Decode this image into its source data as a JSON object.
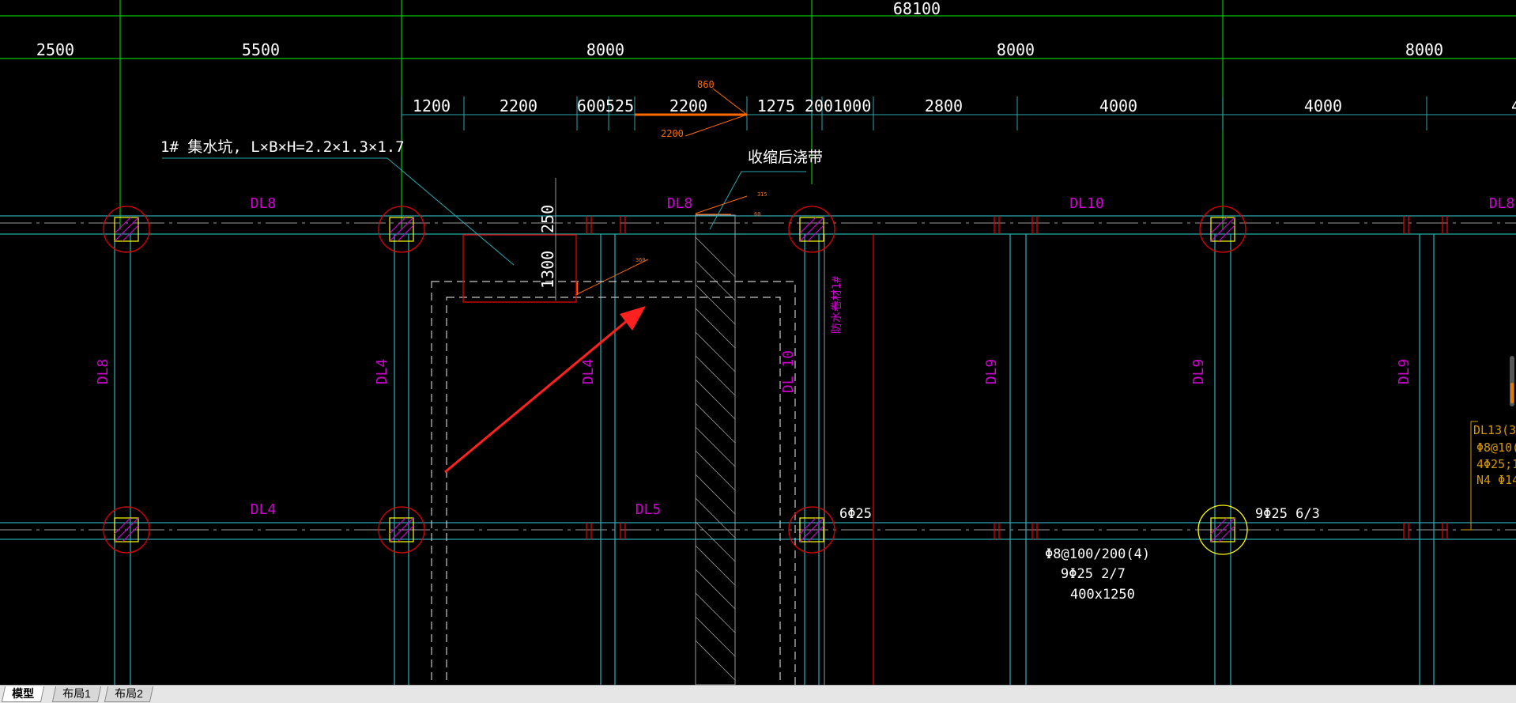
{
  "colors": {
    "grid_axis": "#00c800",
    "beam": "#2aa6b0",
    "beam_label": "#d000d0",
    "column_ring": "#e00000",
    "column_hatch": "#ffff00",
    "dim_text": "#ffffff",
    "annotation_orange": "#ff6a00",
    "note_orange": "#d89800",
    "arrow": "#ff2020",
    "dashed": "#c8c8c8"
  },
  "dims": {
    "total": "68100",
    "axis_spans": [
      "2500",
      "5500",
      "8000",
      "8000",
      "8000"
    ],
    "secondary": [
      "1200",
      "2200",
      "600525",
      "2200",
      "1275 2001000",
      "2800",
      "4000",
      "4000",
      "4"
    ],
    "orange_top": "860",
    "orange_bottom": "2200",
    "pit_width": "250",
    "pit_depth": "1300"
  },
  "annotations": {
    "sump_pit": "1# 集水坑, L×B×H=2.2×1.3×1.7",
    "post_pour_strip": "收缩后浇带",
    "waterproof": "防水卷材1# ",
    "small_orange_1": "315",
    "small_orange_2": "60",
    "small_orange_3": "360"
  },
  "beams": {
    "top_row": [
      "DL8",
      "DL8",
      "DL10",
      "DL8"
    ],
    "mid_row": [
      "DL4",
      "DL5"
    ],
    "vertical": [
      "DL8",
      "DL4",
      "DL4",
      "DL 10",
      "DL9",
      "DL9",
      "DL9"
    ]
  },
  "rebar": {
    "col_a": "6Φ25",
    "col_b": "9Φ25 6/3",
    "stirrup": "Φ8@100/200(4)",
    "main": "9Φ25 2/7",
    "section": "400x1250"
  },
  "side_note": [
    "DL13(3)",
    "Φ8@10(",
    "4Φ25;12",
    "N4 Φ14"
  ],
  "tabs": [
    {
      "label": "模型",
      "active": true
    },
    {
      "label": "布局1",
      "active": false
    },
    {
      "label": "布局2",
      "active": false
    }
  ]
}
